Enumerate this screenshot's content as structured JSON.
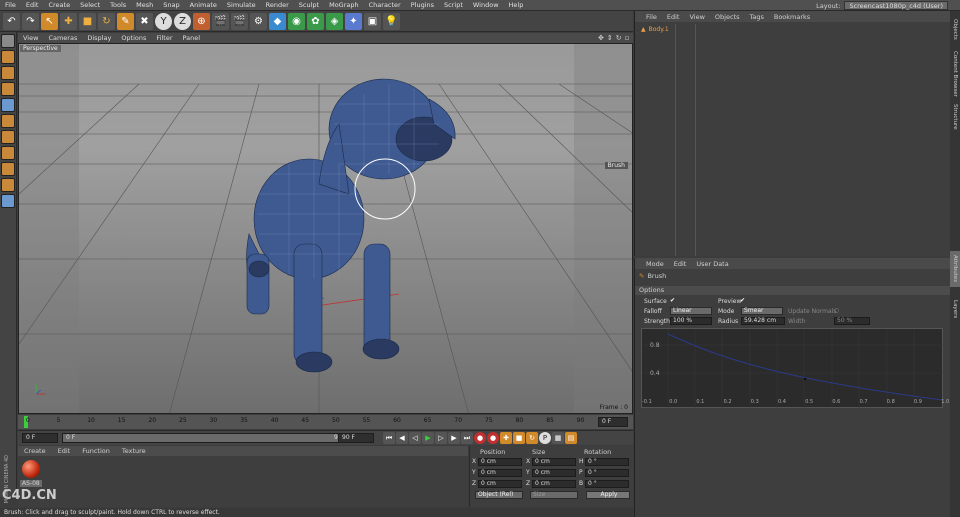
{
  "menu": [
    "File",
    "Edit",
    "Create",
    "Select",
    "Tools",
    "Mesh",
    "Snap",
    "Animate",
    "Simulate",
    "Render",
    "Sculpt",
    "MoGraph",
    "Character",
    "Plugins",
    "Script",
    "Window",
    "Help"
  ],
  "layout": {
    "label": "Layout:",
    "value": "Screencast1080p_c4d (User)"
  },
  "viewport": {
    "menu": [
      "View",
      "Cameras",
      "Display",
      "Options",
      "Filter",
      "Panel"
    ],
    "label": "Perspective",
    "brush_tag": "Brush",
    "frame": "Frame : 0"
  },
  "timeline": {
    "ticks": [
      "0",
      "5",
      "10",
      "15",
      "20",
      "25",
      "30",
      "35",
      "40",
      "45",
      "50",
      "55",
      "60",
      "65",
      "70",
      "75",
      "80",
      "85",
      "90"
    ],
    "end": "0 F"
  },
  "transport": {
    "start": "0 F",
    "range_start": "0 F",
    "range_end": "90 F",
    "end": "90 F"
  },
  "material": {
    "menu": [
      "Create",
      "Edit",
      "Function",
      "Texture"
    ],
    "name": "AS-08"
  },
  "coords": {
    "headers": [
      "Position",
      "Size",
      "Rotation"
    ],
    "rows": [
      {
        "a": "X",
        "p": "0 cm",
        "b": "X",
        "s": "0 cm",
        "c": "H",
        "r": "0 °"
      },
      {
        "a": "Y",
        "p": "0 cm",
        "b": "Y",
        "s": "0 cm",
        "c": "P",
        "r": "0 °"
      },
      {
        "a": "Z",
        "p": "0 cm",
        "b": "Z",
        "s": "0 cm",
        "c": "B",
        "r": "0 °"
      }
    ],
    "mode": "Object (Rel)",
    "size_mode": "Size",
    "apply": "Apply"
  },
  "status": "Brush: Click and drag to sculpt/paint. Hold down CTRL to reverse effect.",
  "objects": {
    "menu": [
      "File",
      "Edit",
      "View",
      "Objects",
      "Tags",
      "Bookmarks"
    ],
    "item": "Body.1"
  },
  "attributes": {
    "menu": [
      "Mode",
      "Edit",
      "User Data"
    ],
    "tool": "Brush",
    "section": "Options",
    "surface_label": "Surface",
    "preview_label": "Preview",
    "falloff_label": "Falloff",
    "falloff": "Linear",
    "mode_label": "Mode",
    "mode": "Smear",
    "update_normals": "Update Normals",
    "strength_label": "Strength",
    "strength": "100 %",
    "radius_label": "Radius",
    "radius": "59.428 cm",
    "width_label": "Width",
    "width": "50 %",
    "graph_y": [
      "0.8",
      "0.4"
    ],
    "graph_x": [
      "-0.1",
      "0.0",
      "0.1",
      "0.2",
      "0.3",
      "0.4",
      "0.5",
      "0.6",
      "0.7",
      "0.8",
      "0.9",
      "1.0"
    ]
  },
  "right_tabs": [
    "Objects",
    "Content Browser",
    "Structure",
    "Attributes",
    "Layers"
  ],
  "watermark": "C4D.CN",
  "logo": "MAXON CINEMA 4D"
}
